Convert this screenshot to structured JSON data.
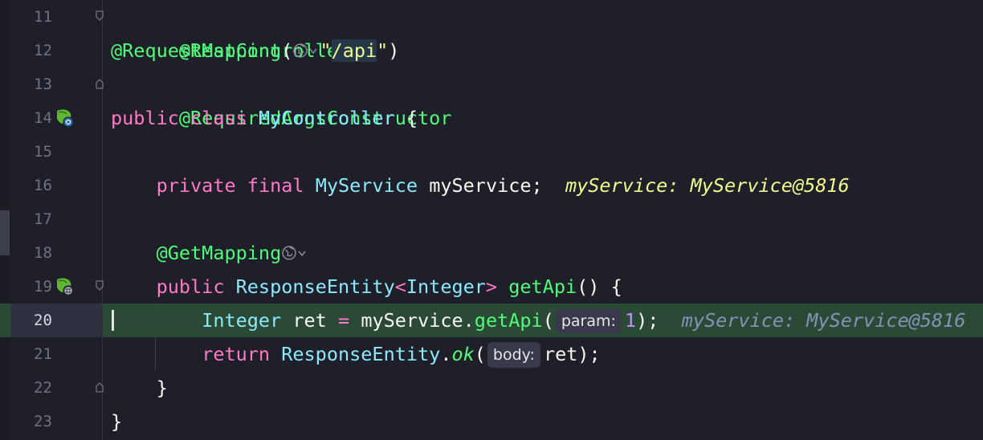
{
  "editor": {
    "current_line": "20",
    "lines": [
      {
        "num": "11",
        "tokens": {
          "ann": "@RestController"
        }
      },
      {
        "num": "12",
        "tokens": {
          "ann": "@RequestMapping",
          "open": "(",
          "str_open": "\"",
          "str_val": "/api",
          "str_close": "\"",
          "close": ")"
        }
      },
      {
        "num": "13",
        "tokens": {
          "ann": "@RequiredArgsConstructor"
        }
      },
      {
        "num": "14",
        "tokens": {
          "kw1": "public",
          "kw2": "class",
          "type": "MyController",
          "brace": "{"
        }
      },
      {
        "num": "15"
      },
      {
        "num": "16",
        "tokens": {
          "kw1": "private",
          "kw2": "final",
          "type": "MyService",
          "name": "myService;",
          "inlay": "myService: MyService@5816"
        }
      },
      {
        "num": "17"
      },
      {
        "num": "18",
        "tokens": {
          "ann": "@GetMapping"
        }
      },
      {
        "num": "19",
        "tokens": {
          "kw1": "public",
          "type": "ResponseEntity",
          "lt": "<",
          "type2": "Integer",
          "gt": ">",
          "fn": "getApi",
          "rest": "() {"
        }
      },
      {
        "num": "20",
        "tokens": {
          "type": "Integer",
          "var": "ret",
          "eq": "=",
          "obj": "myService.",
          "fn": "getApi",
          "open": "(",
          "hint": "param:",
          "num": "1",
          "close": ");",
          "inlay": "myService: MyService@5816"
        }
      },
      {
        "num": "21",
        "tokens": {
          "kw": "return",
          "type": "ResponseEntity",
          "dot": ".",
          "fn": "ok",
          "open": "(",
          "hint": "body:",
          "rest": "ret);"
        }
      },
      {
        "num": "22",
        "tokens": {
          "brace": "}"
        }
      },
      {
        "num": "23",
        "tokens": {
          "brace": "}"
        }
      }
    ]
  },
  "icons": {
    "bean": "spring-bean-icon",
    "endpoint": "web-endpoint-icon",
    "globe": "globe-icon",
    "fold": "fold-marker-icon"
  },
  "colors": {
    "background": "#1e1f28",
    "current_line": "#2b4a35",
    "keyword": "#ff79c6",
    "annotation": "#50fa7b",
    "type": "#8be9fd",
    "string": "#f1fa8c",
    "number": "#bd93f9"
  }
}
